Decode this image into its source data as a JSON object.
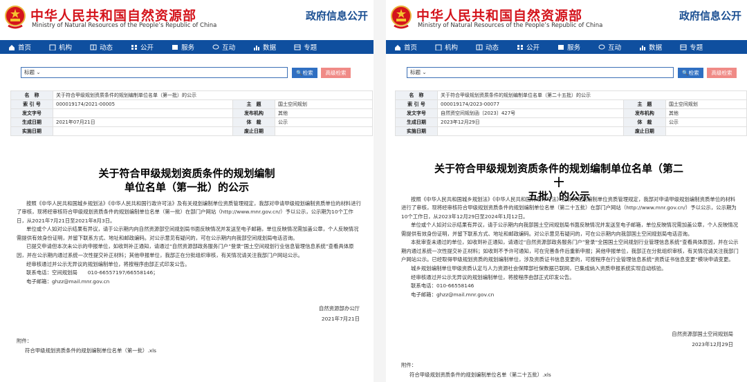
{
  "site": {
    "cn_title": "中华人民共和国自然资源部",
    "en_title": "Ministry of Natural Resources of the People’s Republic of China",
    "gov_info": "政府信息公开"
  },
  "nav": [
    "首页",
    "机构",
    "动态",
    "公开",
    "服务",
    "互动",
    "数据",
    "专题"
  ],
  "search": {
    "select_label": "标题",
    "search_label": "检索",
    "advanced_label": "高级检索"
  },
  "labels": {
    "name": "名　称",
    "index_no": "索 引 号",
    "doc_no": "发文字号",
    "date": "生成日期",
    "effective": "实施日期",
    "subject": "主　题",
    "issuer": "发布机构",
    "form": "体　裁",
    "repeal": "废止日期"
  },
  "left": {
    "meta": {
      "name": "关于符合甲级规划资质条件的规划编制单位名单（第一批）的公示",
      "index_no": "000019174/2021-00005",
      "doc_no": "",
      "date": "2021年07月21日",
      "effective": "",
      "subject": "国土空间规划",
      "issuer": "其他",
      "form": "公示",
      "repeal": ""
    },
    "title_line1": "关于符合甲级规划资质条件的规划编制",
    "title_line2": "单位名单（第一批）的公示",
    "paragraphs": [
      "按照《中华人民共和国城乡规划法》《中华人民共和国行政许可法》及有关规划编制单位资质管理规定，我部对申请甲级规划编制资质单位的材料进行了审核，现将经审核符合甲级规划资质条件的规划编制单位名单（第一批）在部门户网站（http://www.mnr.gov.cn/）予以公示，公示期为10个工作日，从2021年7月21日至2021年8月3日。",
      "单位或个人如对公示结果有异议，请于公示期内向自然资源部空间规划局书面反映情况并发送至电子邮箱，单位反映情况需加盖公章，个人反映情况需提供有效身份证明，并留下联系方式、地址和邮政编码。对公示意见有疑问的，可在公示期内向我部空间规划局电话咨询。",
      "已提交申请但本次未公示的申报单位，如收到补正通知，请通过“自然资源部政务服务门户”登录“国土空间规划行业信息管理信息系统”查看具体原因，并在公示期内通过系统一次性提交补正材料；其他申报单位，我部正在分批组织审核，有关情况请关注我部门户网站公示。",
      "经审核通过并公示无异议的规划编制单位，将按程序由部正式印发公告。"
    ],
    "contact_tel": "联系电话：空间规划局　　010-66557197/66558146；",
    "contact_email": "电子邮箱：ghzz@mail.mnr.gov.cn",
    "sign_org": "自然资源部办公厅",
    "sign_date": "2021年7月21日",
    "attach_label": "附件：",
    "attach_file": "符合甲级规划资质条件的规划编制单位名单（第一批）.xls"
  },
  "right": {
    "meta": {
      "name": "关于符合甲级规划资质条件的规划编制单位名单（第二十五批）的公示",
      "index_no": "000019174/2023-00077",
      "doc_no": "自然资空间规划函〔2023〕427号",
      "date": "2023年12月29日",
      "effective": "",
      "subject": "国土空间规划",
      "issuer": "其他",
      "form": "公示",
      "repeal": ""
    },
    "title_line1": "关于符合甲级规划资质条件的规划编制单位名单（第二十",
    "title_line2": "五批）的公示",
    "paragraphs": [
      "按照《中华人民共和国城乡规划法》《中华人民共和国行政许可法》及有关规划编制单位资质管理规定，我部对申请甲级规划编制资质单位的材料进行了审核，现将经审核符合甲级规划资质条件的规划编制单位名单（第二十五批）在部门户网站（http://www.mnr.gov.cn/）予以公示，公示期为10个工作日，从2023年12月29日至2024年1月12日。",
      "单位或个人如对公示结果有异议，请于公示期内向我部国土空间规划局书面反映情况并发送至电子邮箱，单位反映情况需加盖公章，个人反映情况需提供有效身份证明，并留下联系方式、地址和邮政编码。对公示意见有疑问的，可在公示期内向我部国土空间规划局电话咨询。",
      "本批审查未通过的单位，如收到补正通知，请通过“自然资源部政务服务门户”登录“全国国土空间规划行业管理信息系统”查看具体原因，并在公示期内通过系统一次性提交补正材料；如收到不予许可通知，可在完善条件后重新申报；其他申报单位，我部正在分批组织审核，有关情况请关注我部门户网站公示。已经取得甲级规划资质的规划编制单位，涉及资质证书信息变更的，可按程序在行业管理信息系统“资质证书信息变更”模块申请变更。",
      "城乡规划编制单位甲级资质认定与人力资源社会保障部社保数据已联网，已集成纳入资质申报系统实现自动核验。",
      "经审核通过并公示无异议的规划编制单位，将按程序由部正式印发公告。"
    ],
    "contact_tel": "联系电话：010-66558146",
    "contact_email": "电子邮箱：ghzz@mail.mnr.gov.cn",
    "sign_org": "自然资源部国土空间规划局",
    "sign_date": "2023年12月29日",
    "attach_label": "附件：",
    "attach_file": "符合甲级规划资质条件的规划编制单位名单（第二十五批）.xls"
  }
}
